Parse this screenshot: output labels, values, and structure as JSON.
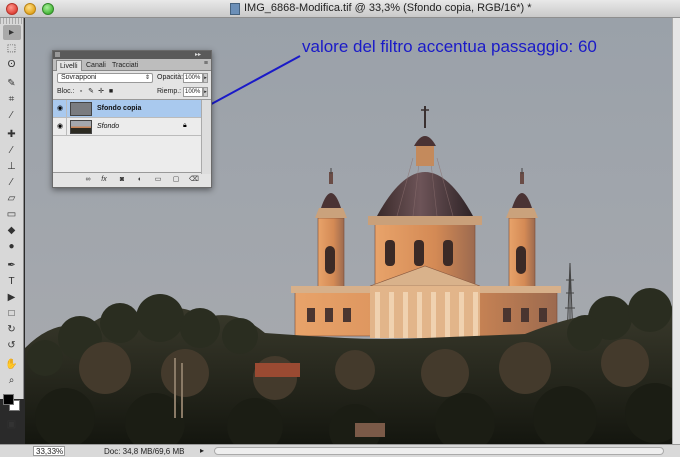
{
  "window": {
    "title": "IMG_6868-Modifica.tif @ 33,3% (Sfondo copia, RGB/16*) *"
  },
  "tools": [
    {
      "icon": "move-icon",
      "glyph": "▸"
    },
    {
      "icon": "marquee-icon",
      "glyph": "⬚"
    },
    {
      "icon": "lasso-icon",
      "glyph": "ʘ"
    },
    {
      "icon": "quick-select-icon",
      "glyph": "✎"
    },
    {
      "icon": "crop-icon",
      "glyph": "⌗"
    },
    {
      "icon": "eyedropper-icon",
      "glyph": "⁄"
    },
    {
      "icon": "healing-icon",
      "glyph": "✚"
    },
    {
      "icon": "brush-icon",
      "glyph": "⁄"
    },
    {
      "icon": "clone-stamp-icon",
      "glyph": "⊥"
    },
    {
      "icon": "history-brush-icon",
      "glyph": "⁄"
    },
    {
      "icon": "eraser-icon",
      "glyph": "▱"
    },
    {
      "icon": "gradient-icon",
      "glyph": "▭"
    },
    {
      "icon": "blur-icon",
      "glyph": "◆"
    },
    {
      "icon": "dodge-icon",
      "glyph": "●"
    },
    {
      "icon": "pen-icon",
      "glyph": "✒"
    },
    {
      "icon": "type-icon",
      "glyph": "T"
    },
    {
      "icon": "path-select-icon",
      "glyph": "▶"
    },
    {
      "icon": "shape-icon",
      "glyph": "□"
    },
    {
      "icon": "3d-rotate-icon",
      "glyph": "↻"
    },
    {
      "icon": "3d-orbit-icon",
      "glyph": "↺"
    },
    {
      "icon": "hand-icon",
      "glyph": "✋"
    },
    {
      "icon": "zoom-icon",
      "glyph": "⌕"
    }
  ],
  "layers_panel": {
    "tabs": [
      "Livelli",
      "Canali",
      "Tracciati"
    ],
    "blend_mode": "Sovrapponi",
    "opacity_label": "Opacità:",
    "opacity_value": "100%",
    "lock_label": "Bloc.:",
    "fill_label": "Riemp.:",
    "fill_value": "100%",
    "layers": [
      {
        "name": "Sfondo copia",
        "selected": true,
        "locked": false
      },
      {
        "name": "Sfondo",
        "selected": false,
        "locked": true
      }
    ]
  },
  "annotation": {
    "text": "valore del filtro accentua passaggio: 60",
    "color": "#1a1ac8"
  },
  "status": {
    "zoom": "33,33%",
    "doc_info": "Doc: 34,8 MB/69,6 MB"
  }
}
